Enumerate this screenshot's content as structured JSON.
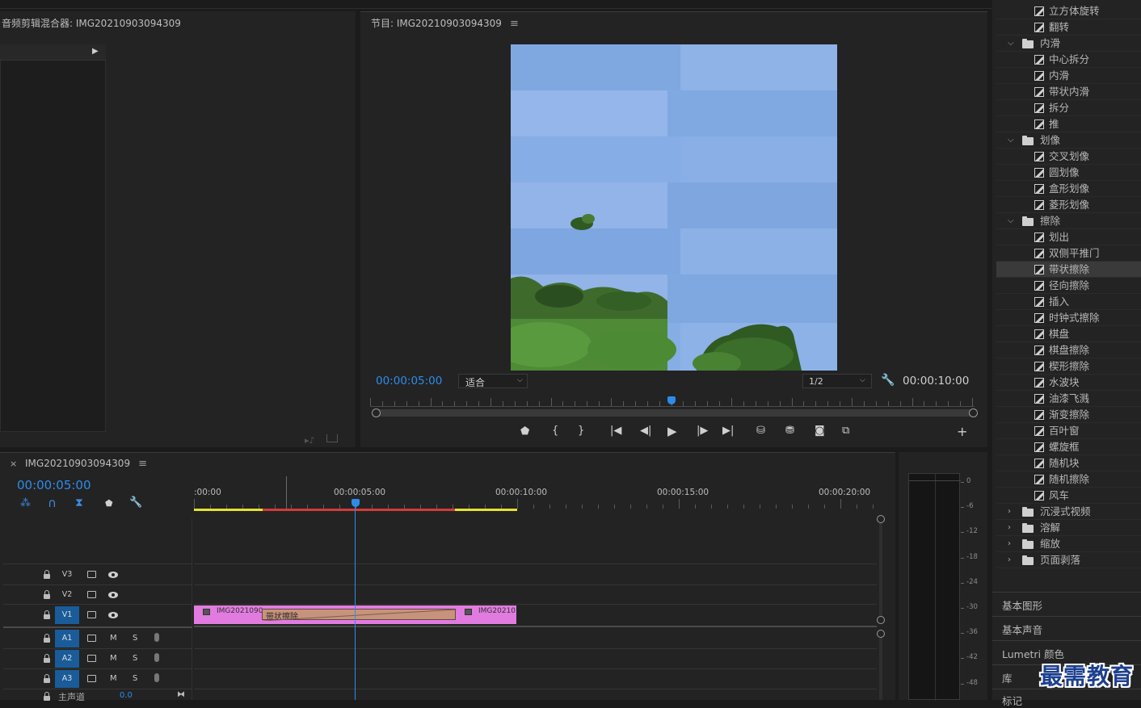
{
  "audio_mixer": {
    "title": "音频剪辑混合器: IMG20210903094309"
  },
  "program": {
    "title": "节目: IMG20210903094309",
    "timecode_current": "00:00:05:00",
    "fit_select": "适合",
    "quality_select": "1/2",
    "timecode_duration": "00:00:10:00"
  },
  "effects_tree": {
    "items": [
      {
        "kind": "effect",
        "label": "立方体旋转"
      },
      {
        "kind": "effect",
        "label": "翻转"
      },
      {
        "kind": "folder",
        "label": "内滑",
        "open": true
      },
      {
        "kind": "effect",
        "label": "中心拆分"
      },
      {
        "kind": "effect",
        "label": "内滑"
      },
      {
        "kind": "effect",
        "label": "带状内滑"
      },
      {
        "kind": "effect",
        "label": "拆分"
      },
      {
        "kind": "effect",
        "label": "推"
      },
      {
        "kind": "folder",
        "label": "划像",
        "open": true
      },
      {
        "kind": "effect",
        "label": "交叉划像"
      },
      {
        "kind": "effect",
        "label": "圆划像"
      },
      {
        "kind": "effect",
        "label": "盒形划像"
      },
      {
        "kind": "effect",
        "label": "菱形划像"
      },
      {
        "kind": "folder",
        "label": "擦除",
        "open": true
      },
      {
        "kind": "effect",
        "label": "划出"
      },
      {
        "kind": "effect",
        "label": "双侧平推门"
      },
      {
        "kind": "effect",
        "label": "带状擦除",
        "selected": true
      },
      {
        "kind": "effect",
        "label": "径向擦除"
      },
      {
        "kind": "effect",
        "label": "插入"
      },
      {
        "kind": "effect",
        "label": "时钟式擦除"
      },
      {
        "kind": "effect",
        "label": "棋盘"
      },
      {
        "kind": "effect",
        "label": "棋盘擦除"
      },
      {
        "kind": "effect",
        "label": "楔形擦除"
      },
      {
        "kind": "effect",
        "label": "水波块"
      },
      {
        "kind": "effect",
        "label": "油漆飞溅"
      },
      {
        "kind": "effect",
        "label": "渐变擦除"
      },
      {
        "kind": "effect",
        "label": "百叶窗"
      },
      {
        "kind": "effect",
        "label": "螺旋框"
      },
      {
        "kind": "effect",
        "label": "随机块"
      },
      {
        "kind": "effect",
        "label": "随机擦除"
      },
      {
        "kind": "effect",
        "label": "风车"
      },
      {
        "kind": "folder",
        "label": "沉浸式视频",
        "open": false
      },
      {
        "kind": "folder",
        "label": "溶解",
        "open": false
      },
      {
        "kind": "folder",
        "label": "缩放",
        "open": false
      },
      {
        "kind": "folder",
        "label": "页面剥落",
        "open": false
      }
    ]
  },
  "side_panels": [
    "基本图形",
    "基本声音",
    "Lumetri 颜色",
    "库",
    "标记"
  ],
  "timeline": {
    "close": "×",
    "title": "IMG20210903094309",
    "timecode": "00:00:05:00",
    "ruler": [
      ":00:00",
      "00:00:05:00",
      "00:00:10:00",
      "00:00:15:00",
      "00:00:20:00"
    ],
    "tracks": {
      "v3": "V3",
      "v2": "V2",
      "v1": "V1",
      "a1": "A1",
      "a2": "A2",
      "a3": "A3",
      "m": "M",
      "s": "S",
      "master": "主声道",
      "master_val": "0.0"
    },
    "clip_left": "IMG2021090",
    "clip_right": "IMG20210",
    "transition": "带状擦除"
  },
  "meter": {
    "labels": [
      "0",
      "-6",
      "-12",
      "-18",
      "-24",
      "-30",
      "-36",
      "-42",
      "-48"
    ]
  },
  "watermark": "最需教育",
  "colors": {
    "accent": "#2d8ceb",
    "clip": "#e27be0",
    "transition": "#c8937b",
    "work_red": "#d13b3b",
    "work_yellow": "#e4e132",
    "sky": "#85aee6"
  }
}
